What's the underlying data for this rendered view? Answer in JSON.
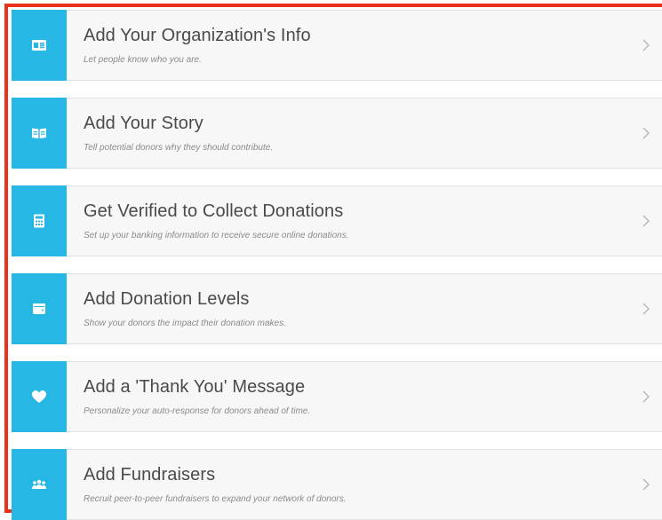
{
  "colors": {
    "accent": "#27b7e4",
    "frame": "#e8321b",
    "row_bg": "#f7f7f7",
    "title": "#4a4a4a",
    "subtitle": "#8a8a8a"
  },
  "steps": [
    {
      "icon": "id-card-icon",
      "title": "Add Your Organization's Info",
      "subtitle": "Let people know who you are."
    },
    {
      "icon": "open-book-icon",
      "title": "Add Your Story",
      "subtitle": "Tell potential donors why they should contribute."
    },
    {
      "icon": "calculator-icon",
      "title": "Get Verified to Collect Donations",
      "subtitle": "Set up your banking information to receive secure online donations."
    },
    {
      "icon": "wallet-icon",
      "title": "Add Donation Levels",
      "subtitle": "Show your donors the impact their donation makes."
    },
    {
      "icon": "heart-icon",
      "title": "Add a 'Thank You' Message",
      "subtitle": "Personalize your auto-response for donors ahead of time."
    },
    {
      "icon": "people-group-icon",
      "title": "Add Fundraisers",
      "subtitle": "Recruit peer-to-peer fundraisers to expand your network of donors."
    }
  ]
}
